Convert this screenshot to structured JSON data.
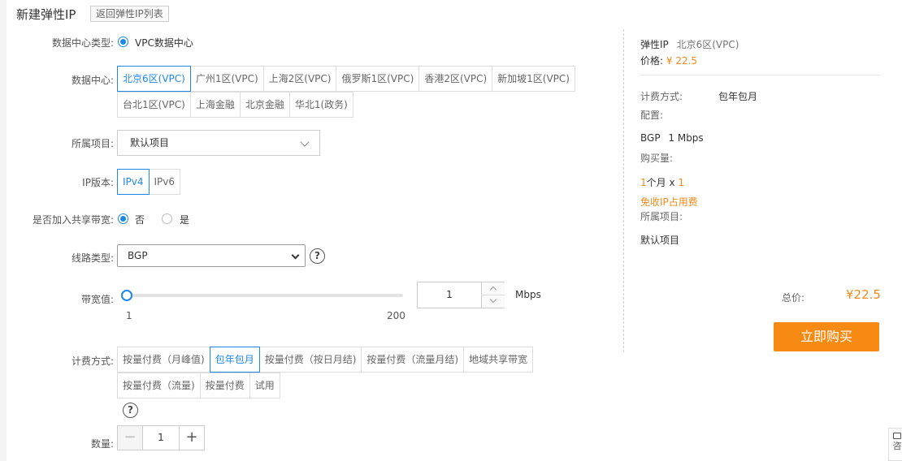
{
  "header": {
    "title": "新建弹性IP",
    "back_link": "返回弹性IP列表"
  },
  "form": {
    "dc_type": {
      "label": "数据中心类型:",
      "option": "VPC数据中心"
    },
    "datacenter": {
      "label": "数据中心:",
      "row1": [
        "北京6区(VPC)",
        "广州1区(VPC)",
        "上海2区(VPC)",
        "俄罗斯1区(VPC)",
        "香港2区(VPC)",
        "新加坡1区(VPC)"
      ],
      "row2": [
        "台北1区(VPC)",
        "上海金融",
        "北京金融",
        "华北1(政务)"
      ],
      "selected": "北京6区(VPC)"
    },
    "project": {
      "label": "所属项目:",
      "value": "默认项目"
    },
    "ip_version": {
      "label": "IP版本:",
      "options": [
        "IPv4",
        "IPv6"
      ],
      "selected": "IPv4"
    },
    "shared_bw": {
      "label": "是否加入共享带宽:",
      "options": [
        "否",
        "是"
      ],
      "selected": "否"
    },
    "line_type": {
      "label": "线路类型:",
      "value": "BGP",
      "help": "?"
    },
    "bandwidth": {
      "label": "带宽值:",
      "min": "1",
      "max": "200",
      "value": "1",
      "unit": "Mbps"
    },
    "billing": {
      "label": "计费方式:",
      "row1": [
        "按量付费（月峰值)",
        "包年包月",
        "按量付费（按日月结)",
        "按量付费（流量月结)",
        "地域共享带宽"
      ],
      "row2": [
        "按量付费（流量)",
        "按量付费",
        "试用"
      ],
      "selected": "包年包月",
      "help": "?"
    },
    "quantity": {
      "label": "数量:",
      "value": "1",
      "minus": "−",
      "plus": "+"
    }
  },
  "summary": {
    "product": "弹性IP",
    "region": "北京6区(VPC)",
    "price_label": "价格:",
    "price": "¥ 22.5",
    "billing_label": "计费方式:",
    "billing_value": "包年包月",
    "config_label": "配置:",
    "config_line": "BGP",
    "config_bw": "1 Mbps",
    "qty_label": "购买量:",
    "qty_num": "1",
    "qty_unit": "个月 x",
    "qty_count": "1",
    "free_note": "免收IP占用费",
    "project_label": "所属项目:",
    "project_value": "默认项目",
    "total_label": "总价:",
    "total_value": "¥22.5",
    "buy_button": "立即购买"
  },
  "consult": {
    "label": "咨"
  },
  "colors": {
    "accent": "#1e88e5",
    "price": "#f08a1a",
    "buy": "#f78a12"
  }
}
